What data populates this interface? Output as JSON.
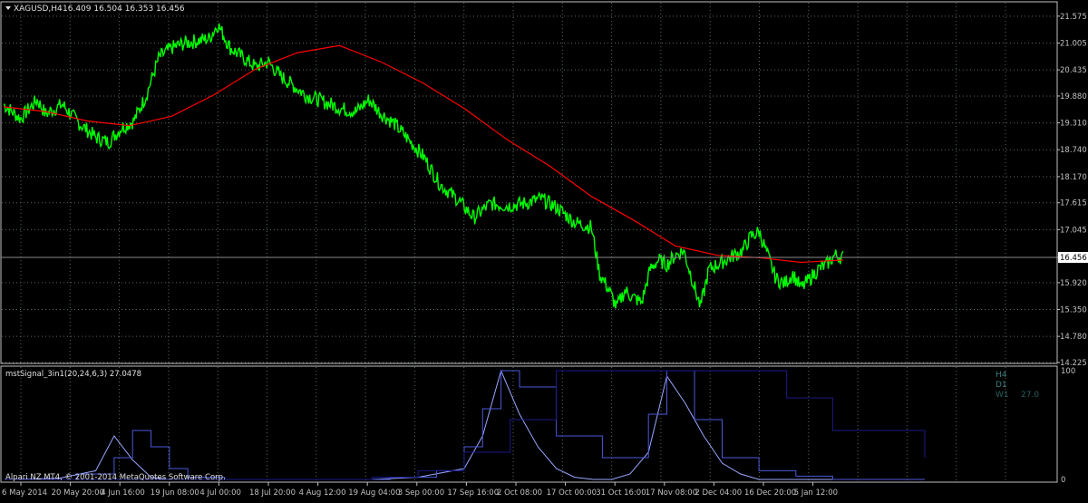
{
  "header": {
    "symbol": "XAGUSD,H4",
    "ohlc": "16.409 16.504 16.353 16.456"
  },
  "indicator": {
    "title": "mstSignal_3in1(20,24,6,3) 27.0478",
    "labels": [
      "H4",
      "D1",
      "W1",
      "27.0"
    ]
  },
  "copyright": "Alpari NZ MT4, © 2001-2014 MetaQuotes Software Corp.",
  "colors": {
    "background": "#000000",
    "grid": "#5a6a5a",
    "axis": "#c0c0c0",
    "price": "#00ff00",
    "ma": "#ff0000",
    "indicator_h4": "#9aa6ff",
    "indicator_d1": "#4a58d8",
    "indicator_w1": "#1a1a88",
    "current_price_bg": "#ffffff",
    "panel_label": "#3d7f7f"
  },
  "chart_data": [
    {
      "type": "line",
      "title": "XAGUSD,H4",
      "ylim": [
        14.225,
        21.86
      ],
      "y_ticks": [
        21.575,
        21.005,
        20.435,
        19.88,
        19.31,
        18.74,
        18.17,
        17.615,
        17.045,
        16.456,
        15.92,
        15.35,
        14.78,
        14.225
      ],
      "y_tick_labels": [
        "21.575",
        "21.005",
        "20.435",
        "19.880",
        "19.310",
        "18.740",
        "18.170",
        "17.615",
        "17.045",
        "16.456",
        "15.920",
        "15.350",
        "14.780",
        "14.225"
      ],
      "current_price": 16.456,
      "x_tick_labels": [
        "6 May 2014",
        "20 May 20:00",
        "4 Jun 16:00",
        "19 Jun 08:00",
        "4 Jul 00:00",
        "18 Jul 20:00",
        "4 Aug 12:00",
        "19 Aug 04:00",
        "3 Sep 00:00",
        "17 Sep 16:00",
        "2 Oct 08:00",
        "17 Oct 00:00",
        "31 Oct 16:00",
        "17 Nov 08:00",
        "2 Dec 04:00",
        "16 Dec 20:00",
        "5 Jan 12:00"
      ],
      "series": [
        {
          "role": "price",
          "x": [
            0,
            0.02,
            0.04,
            0.05,
            0.07,
            0.09,
            0.11,
            0.125,
            0.14,
            0.155,
            0.17,
            0.185,
            0.2,
            0.215,
            0.23,
            0.245,
            0.255,
            0.27,
            0.285,
            0.3,
            0.315,
            0.33,
            0.345,
            0.36,
            0.375,
            0.39,
            0.405,
            0.42,
            0.435,
            0.45,
            0.465,
            0.48,
            0.5,
            0.52,
            0.54,
            0.56,
            0.58,
            0.6,
            0.62,
            0.64,
            0.66,
            0.68,
            0.7,
            0.71,
            0.72,
            0.73,
            0.74,
            0.75,
            0.76,
            0.77,
            0.78,
            0.79,
            0.8,
            0.81,
            0.82,
            0.83,
            0.84,
            0.85,
            0.86,
            0.87,
            0.88,
            0.89,
            0.9,
            0.91,
            0.92,
            0.93,
            0.94,
            0.95,
            0.96,
            0.97,
            0.98,
            0.99,
            1.0
          ],
          "y": [
            19.7,
            19.4,
            19.8,
            19.5,
            19.7,
            19.3,
            19.0,
            18.9,
            19.2,
            19.35,
            19.9,
            20.7,
            20.9,
            21.0,
            21.05,
            21.1,
            21.4,
            20.9,
            20.7,
            20.5,
            20.6,
            20.3,
            20.1,
            19.9,
            19.8,
            19.7,
            19.6,
            19.55,
            19.8,
            19.5,
            19.3,
            19.0,
            18.6,
            18.0,
            17.7,
            17.3,
            17.6,
            17.55,
            17.6,
            17.7,
            17.5,
            17.2,
            17.1,
            16.1,
            15.8,
            15.4,
            15.75,
            15.6,
            15.5,
            16.2,
            16.4,
            16.3,
            16.5,
            16.6,
            16.0,
            15.4,
            16.2,
            16.3,
            16.4,
            16.5,
            16.6,
            16.9,
            17.0,
            16.5,
            16.0,
            15.9,
            16.1,
            15.8,
            16.0,
            16.2,
            16.3,
            16.5,
            16.456
          ]
        },
        {
          "role": "moving-average",
          "x": [
            0,
            0.05,
            0.1,
            0.15,
            0.2,
            0.25,
            0.3,
            0.35,
            0.4,
            0.45,
            0.5,
            0.55,
            0.6,
            0.65,
            0.7,
            0.75,
            0.8,
            0.85,
            0.9,
            0.95,
            1.0
          ],
          "y": [
            19.65,
            19.55,
            19.35,
            19.25,
            19.45,
            19.9,
            20.45,
            20.8,
            20.95,
            20.6,
            20.15,
            19.6,
            18.95,
            18.4,
            17.75,
            17.25,
            16.7,
            16.5,
            16.45,
            16.35,
            16.4
          ]
        }
      ]
    },
    {
      "type": "line",
      "title": "mstSignal_3in1(20,24,6,3) 27.0478",
      "ylim": [
        0,
        100
      ],
      "y_ticks": [
        100,
        0
      ],
      "y_tick_labels": [
        "100",
        "0"
      ],
      "series": [
        {
          "name": "H4",
          "x": [
            0,
            0.06,
            0.1,
            0.12,
            0.14,
            0.16,
            0.18,
            0.2,
            0.22,
            0.26,
            0.3,
            0.35,
            0.4,
            0.45,
            0.5,
            0.52,
            0.54,
            0.56,
            0.58,
            0.6,
            0.62,
            0.64,
            0.66,
            0.68,
            0.7,
            0.72,
            0.74,
            0.76,
            0.78,
            0.8,
            0.82,
            0.84,
            0.9,
            1.0
          ],
          "y": [
            0,
            1,
            8,
            40,
            18,
            2,
            0,
            0,
            0,
            0,
            0,
            0,
            0,
            2,
            10,
            40,
            100,
            60,
            30,
            10,
            2,
            0,
            0,
            5,
            25,
            95,
            70,
            40,
            15,
            5,
            0,
            0,
            0,
            0
          ]
        },
        {
          "name": "D1",
          "x": [
            0,
            0.08,
            0.12,
            0.14,
            0.16,
            0.18,
            0.2,
            0.24,
            0.3,
            0.36,
            0.42,
            0.47,
            0.5,
            0.52,
            0.54,
            0.56,
            0.6,
            0.65,
            0.7,
            0.72,
            0.75,
            0.78,
            0.82,
            0.86,
            0.9,
            1.0
          ],
          "y": [
            0,
            5,
            20,
            45,
            30,
            10,
            2,
            0,
            0,
            0,
            2,
            8,
            30,
            65,
            100,
            85,
            40,
            20,
            60,
            100,
            55,
            20,
            8,
            3,
            0,
            0
          ]
        },
        {
          "name": "W1",
          "x": [
            0,
            0.1,
            0.2,
            0.3,
            0.4,
            0.45,
            0.5,
            0.55,
            0.6,
            0.65,
            0.7,
            0.75,
            0.8,
            0.85,
            0.9,
            1.0
          ],
          "y": [
            0,
            0,
            0,
            0,
            2,
            8,
            25,
            55,
            100,
            100,
            100,
            100,
            100,
            75,
            45,
            20
          ]
        }
      ]
    }
  ]
}
